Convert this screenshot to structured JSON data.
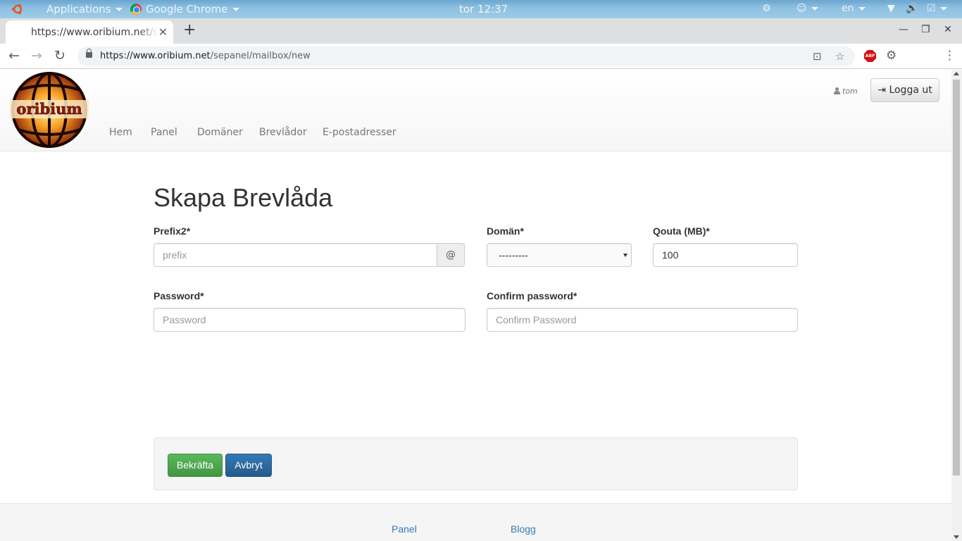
{
  "system_bar": {
    "applications_label": "Applications",
    "active_app_label": "Google Chrome",
    "clock": "tor 12:37",
    "keyboard_layout": "en"
  },
  "browser": {
    "tab_title": "https://www.oribium.net/sepanel/mailbox/new",
    "url_host": "https://www.oribium.net",
    "url_path": "/sepanel/mailbox/new",
    "extension_abp": "ABP"
  },
  "site": {
    "logo_text": "oribium",
    "nav": [
      "Hem",
      "Panel",
      "Domäner",
      "Brevlådor",
      "E-postadresser"
    ],
    "username": "tom",
    "logout_label": "Logga ut"
  },
  "form": {
    "title": "Skapa Brevlåda",
    "prefix_label": "Prefix2*",
    "prefix_placeholder": "prefix",
    "at_sign": "@",
    "domain_label": "Domän*",
    "domain_selected": "---------",
    "quota_label": "Qouta (MB)*",
    "quota_value": "100",
    "password_label": "Password*",
    "password_placeholder": "Password",
    "confirm_label": "Confirm password*",
    "confirm_placeholder": "Confirm Password",
    "submit_label": "Bekräfta",
    "cancel_label": "Avbryt"
  },
  "footer": {
    "links": [
      "Panel",
      "Blogg"
    ]
  },
  "colors": {
    "primary": "#337ab7",
    "success": "#5cb85c",
    "logo_red": "#8b1a0a"
  }
}
